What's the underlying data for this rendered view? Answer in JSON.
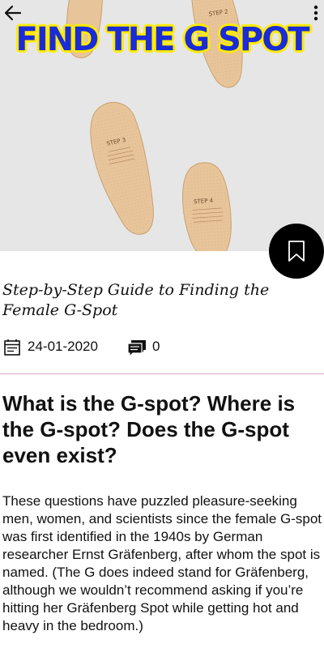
{
  "hero": {
    "title": "FIND THE G SPOT",
    "insoles": [
      "STEP 2",
      "STEP 3",
      "STEP 4"
    ]
  },
  "toolbar": {
    "back_icon": "arrow-left-icon",
    "menu_icon": "more-vertical-icon"
  },
  "fab": {
    "icon": "bookmark-icon"
  },
  "article": {
    "subtitle": "Step-by-Step Guide to Finding the Female G-Spot",
    "date": "24-01-2020",
    "comment_count": "0",
    "heading": "What is the G-spot? Where is the G-spot? Does the G-spot even exist?",
    "body": "These questions have puzzled pleasure-seeking men, women, and scientists since the female G-spot was first identified in the 1940s by German researcher Ernst Gräfenberg, after whom the spot is named. (The G does indeed stand for Gräfenberg, although we wouldn’t recommend asking if you’re hitting her Gräfenberg Spot while getting hot and heavy in the bedroom.)"
  },
  "colors": {
    "hero_background": "#e6e6e6",
    "title_fill": "#1a2bd8",
    "title_outline": "#ffeb00",
    "insole": "#e8c49a",
    "fab": "#000000",
    "divider": "#d9a3c4"
  }
}
